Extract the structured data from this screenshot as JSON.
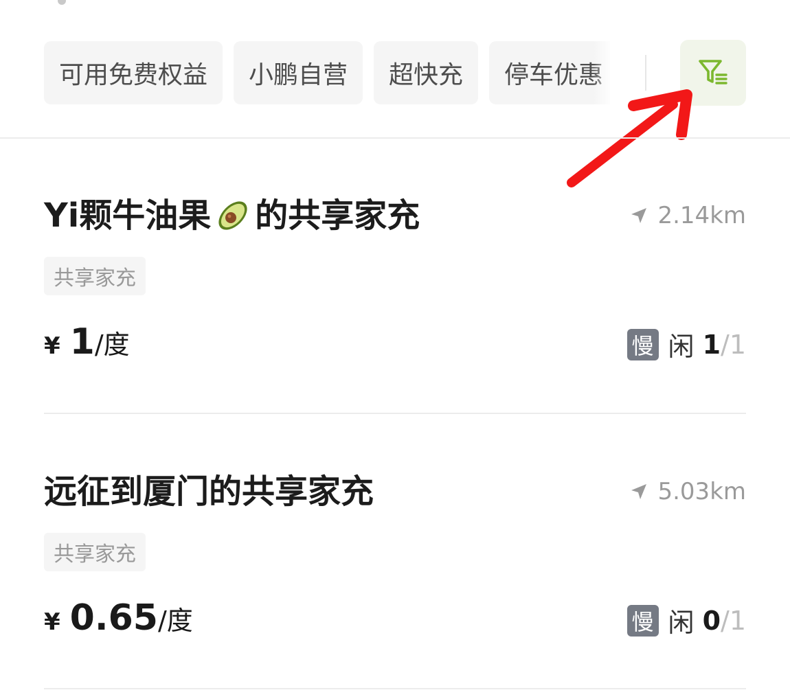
{
  "filters": {
    "chips": [
      "可用免费权益",
      "小鹏自营",
      "超快充",
      "停车优惠"
    ]
  },
  "stations": [
    {
      "name_before": "Yi颗牛油果",
      "name_after": "的共享家充",
      "distance": "2.14km",
      "tag": "共享家充",
      "currency": "¥",
      "price": "1",
      "unit": "/度",
      "speed_badge": "慢",
      "free_label": "闲",
      "free_count": "1",
      "total": "/1"
    },
    {
      "name_before": "远征到厦门的共享家充",
      "name_after": "",
      "distance": "5.03km",
      "tag": "共享家充",
      "currency": "¥",
      "price": "0.65",
      "unit": "/度",
      "speed_badge": "慢",
      "free_label": "闲",
      "free_count": "0",
      "total": "/1"
    }
  ],
  "colors": {
    "accent_green": "#7cb82f",
    "annotation_red": "#f21818",
    "slow_badge": "#757a84"
  },
  "icons": {
    "filter": "filter-funnel-icon",
    "distance": "navigation-arrow-icon",
    "emoji": "avocado-emoji"
  }
}
